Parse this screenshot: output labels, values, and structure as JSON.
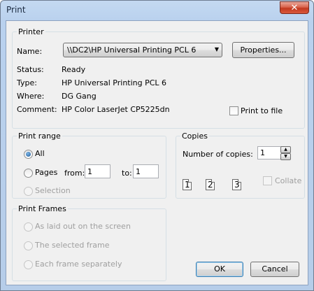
{
  "window": {
    "title": "Print",
    "close_glyph": "✕"
  },
  "printer": {
    "group_label": "Printer",
    "name_label": "Name:",
    "name_value": "\\\\DC2\\HP Universal Printing PCL 6",
    "properties_label": "Properties...",
    "status_label": "Status:",
    "status_value": "Ready",
    "type_label": "Type:",
    "type_value": "HP Universal Printing PCL 6",
    "where_label": "Where:",
    "where_value": "DG Gang",
    "comment_label": "Comment:",
    "comment_value": "HP Color LaserJet CP5225dn",
    "print_to_file_label": "Print to file",
    "print_to_file_checked": false
  },
  "print_range": {
    "group_label": "Print range",
    "all_label": "All",
    "pages_label": "Pages",
    "from_label": "from:",
    "from_value": "1",
    "to_label": "to:",
    "to_value": "1",
    "selection_label": "Selection",
    "selected": "All"
  },
  "copies": {
    "group_label": "Copies",
    "number_label": "Number of copies:",
    "number_value": "1",
    "collate_label": "Collate",
    "collate_checked": false,
    "page_numbers": [
      "1",
      "1",
      "2",
      "2",
      "3",
      "3"
    ]
  },
  "print_frames": {
    "group_label": "Print Frames",
    "options": [
      "As laid out on the screen",
      "The selected frame",
      "Each frame separately"
    ]
  },
  "buttons": {
    "ok": "OK",
    "cancel": "Cancel"
  },
  "icons": {
    "combo_arrow": "▼",
    "spin_up": "▲",
    "spin_down": "▼"
  }
}
